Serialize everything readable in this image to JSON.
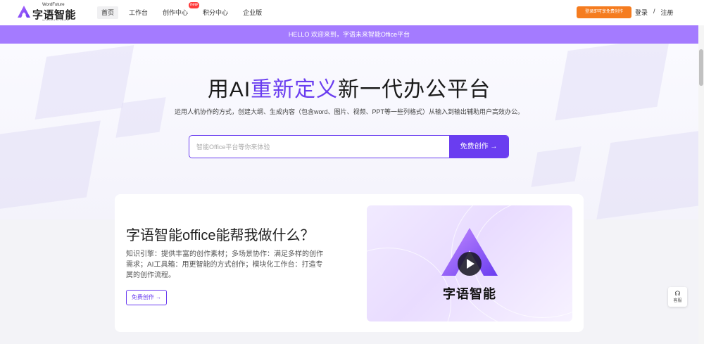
{
  "header": {
    "logo_super": "WordFuture",
    "logo_text": "字语智能",
    "logo_sub": "WORDFUTURE",
    "nav": [
      {
        "label": "首页",
        "active": true
      },
      {
        "label": "工作台"
      },
      {
        "label": "创作中心",
        "badge": "new"
      },
      {
        "label": "积分中心"
      },
      {
        "label": "企业版"
      }
    ],
    "cta": "登录即可享免费创作",
    "login": "登录",
    "separator": "/",
    "register": "注册"
  },
  "banner": {
    "text": "HELLO 欢迎来到，字语未来智能Office平台"
  },
  "hero": {
    "title_pre": "用AI",
    "title_accent": "重新定义",
    "title_post": "新一代办公平台",
    "subtitle": "运用人机协作的方式，创建大纲、生成内容（包含word、图片、视频、PPT等一些列格式）从输入到输出辅助用户高效办公。",
    "search_placeholder": "智能Office平台等你来体验",
    "search_button": "免费创作 →"
  },
  "feature": {
    "title": "字语智能office能帮我做什么？",
    "description": "知识引擎：提供丰富的创作素材；多场景协作：满足多样的创作需求；AI工具箱：用更智能的方式创作；模块化工作台：打造专属的创作流程。",
    "button": "免费创作 →",
    "media_name": "字语智能"
  },
  "float_service": {
    "label": "客服"
  },
  "colors": {
    "primary": "#6a3df0",
    "banner": "#a47bff",
    "cta": "#f57c1f"
  }
}
